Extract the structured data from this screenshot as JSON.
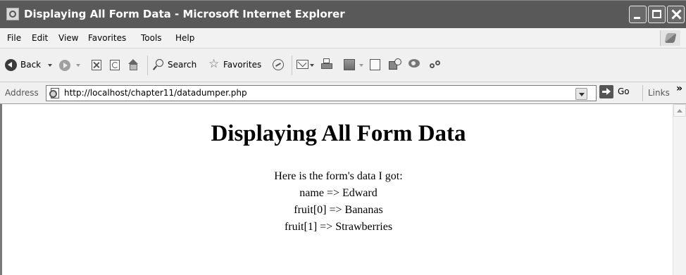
{
  "window": {
    "title": "Displaying All Form Data - Microsoft Internet Explorer"
  },
  "menubar": {
    "items": [
      "File",
      "Edit",
      "View",
      "Favorites",
      "Tools",
      "Help"
    ]
  },
  "toolbar": {
    "back_label": "Back",
    "search_label": "Search",
    "favorites_label": "Favorites"
  },
  "addressbar": {
    "label": "Address",
    "url": "http://localhost/chapter11/datadumper.php",
    "go_label": "Go",
    "links_label": "Links",
    "more_glyph": "»"
  },
  "page": {
    "heading": "Displaying All Form Data",
    "intro": "Here is the form's data I got:",
    "entries": [
      {
        "text": "name => Edward"
      },
      {
        "text": "fruit[0] => Bananas"
      },
      {
        "text": "fruit[1] => Strawberries"
      }
    ]
  },
  "icons": {
    "favorites_glyph": "☆"
  },
  "colors": {
    "titlebar": "#595959",
    "chrome": "#f0f0f0",
    "content_background": "#ffffff"
  }
}
